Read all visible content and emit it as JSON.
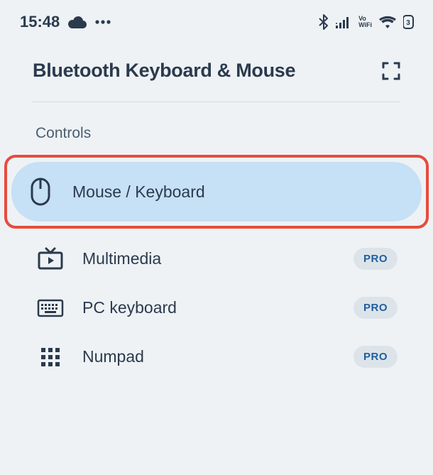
{
  "status": {
    "time": "15:48"
  },
  "header": {
    "title": "Bluetooth Keyboard & Mouse"
  },
  "section_label": "Controls",
  "controls": [
    {
      "label": "Mouse / Keyboard",
      "active": true,
      "pro": false
    },
    {
      "label": "Multimedia",
      "active": false,
      "pro": true
    },
    {
      "label": "PC keyboard",
      "active": false,
      "pro": true
    },
    {
      "label": "Numpad",
      "active": false,
      "pro": true
    }
  ],
  "badge": {
    "pro": "PRO"
  }
}
